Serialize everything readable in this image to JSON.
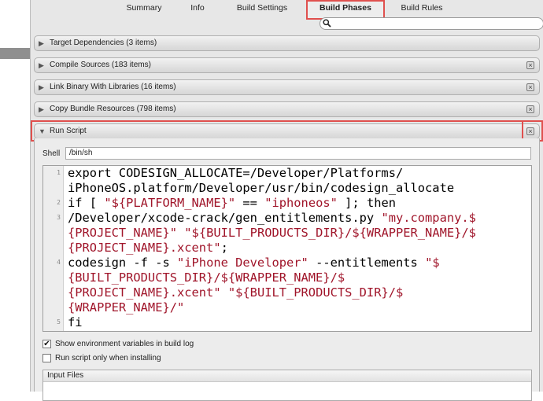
{
  "tabs": [
    {
      "label": "Summary"
    },
    {
      "label": "Info"
    },
    {
      "label": "Build Settings"
    },
    {
      "label": "Build Phases",
      "selected": true
    },
    {
      "label": "Build Rules"
    }
  ],
  "search": {
    "placeholder": "",
    "value": ""
  },
  "phases": [
    {
      "label": "Target Dependencies (3 items)",
      "expanded": false,
      "has_close": false
    },
    {
      "label": "Compile Sources (183 items)",
      "expanded": false,
      "has_close": true
    },
    {
      "label": "Link Binary With Libraries (16 items)",
      "expanded": false,
      "has_close": true
    },
    {
      "label": "Copy Bundle Resources (798 items)",
      "expanded": false,
      "has_close": true
    },
    {
      "label": "Run Script",
      "expanded": true,
      "has_close": true
    }
  ],
  "run_script": {
    "shell_label": "Shell",
    "shell_value": "/bin/sh",
    "line_numbers": [
      "1",
      "2",
      "3",
      "4",
      "5"
    ],
    "code": {
      "l1a": "export CODESIGN_ALLOCATE=/Developer/Platforms/",
      "l1b": "iPhoneOS.platform/Developer/usr/bin/codesign_allocate",
      "l2_pre": "if [ ",
      "l2_str1": "\"${PLATFORM_NAME}\"",
      "l2_mid": " == ",
      "l2_str2": "\"iphoneos\"",
      "l2_post": " ]; then",
      "l3_pre": "/Developer/xcode-crack/gen_entitlements.py ",
      "l3_str1": "\"my.company.$",
      "l3_str1b": "{PROJECT_NAME}\"",
      "l3_sp": " ",
      "l3_str2": "\"${BUILT_PRODUCTS_DIR}/${WRAPPER_NAME}/$",
      "l3_str2b": "{PROJECT_NAME}.xcent\"",
      "l3_post": ";",
      "l4_pre": "codesign -f -s ",
      "l4_str1": "\"iPhone Developer\"",
      "l4_mid": " --entitlements ",
      "l4_str2": "\"$",
      "l4_str2b": "{BUILT_PRODUCTS_DIR}/${WRAPPER_NAME}/$",
      "l4_str2c": "{PROJECT_NAME}.xcent\"",
      "l4_sp": " ",
      "l4_str3": "\"${BUILT_PRODUCTS_DIR}/$",
      "l4_str3b": "{WRAPPER_NAME}/\"",
      "l5": "fi"
    },
    "checkbox_show_env": {
      "label": "Show environment variables in build log",
      "checked": true,
      "mark": "✔"
    },
    "checkbox_install_only": {
      "label": "Run script only when installing",
      "checked": false
    },
    "input_files_label": "Input Files"
  },
  "icons": {
    "search": "search-icon",
    "close": "close-icon",
    "expand_right": "disclosure-right-icon",
    "expand_down": "disclosure-down-icon"
  },
  "colors": {
    "highlight": "#e0504e",
    "string": "#a0152a"
  }
}
